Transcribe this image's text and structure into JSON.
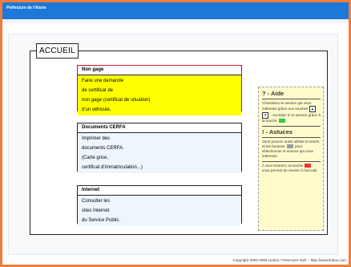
{
  "window": {
    "title": "Préfecture de l'Aisne"
  },
  "page": {
    "heading": "ACCUEIL"
  },
  "menu": [
    {
      "title": "Non gage",
      "lines": [
        "Faire une demande",
        "de certificat de",
        "non gage (certificat de situation)",
        "d'un véhicule."
      ]
    },
    {
      "title": "Documents CERFA",
      "lines": [
        "Imprimer des",
        "documents CERFA.",
        "(Carte grise,",
        "certificat d'immatriculation...)"
      ]
    },
    {
      "title": "Internet",
      "lines": [
        "Consulter les",
        "sites Internet",
        "du Service Public."
      ]
    }
  ],
  "help": {
    "aide_title": "? - Aide",
    "aide_text1": "Choisissez le service qui vous intéresse grâce aux touches",
    "aide_text2": ". Accédez à ce service grâce à la touche",
    "astuces_title": "! - Astuces",
    "astuces_text1": "Vous pouvez aussi utiliser la souris et les boutons",
    "astuces_text2": "pour sélectionner le service qui vous intéresse.",
    "astuces_text3": "À tout moment, la touche",
    "astuces_text4": "vous permet de revenir à l'accueil."
  },
  "footer": {
    "copyright": "Copyright 2003-2009 Linbox / FreeALter Soft -- http://www.linbox.com"
  },
  "colors": {
    "accent": "#1d78d8",
    "border": "#f07d3c",
    "selected": "#ffff00",
    "selected_border": "#c0161e"
  }
}
